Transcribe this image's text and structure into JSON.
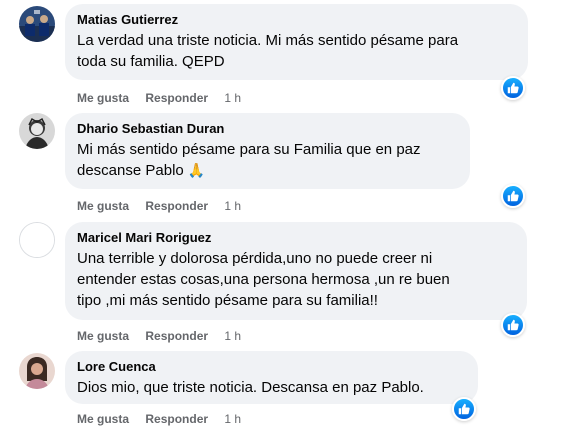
{
  "colors": {
    "bubble_bg": "#f0f2f5",
    "action_text": "#65676b",
    "like_blue": "#1877f2"
  },
  "comments": [
    {
      "author": "Matias Gutierrez",
      "lines": [
        "La verdad una triste noticia. Mi más sentido pésame para",
        "toda su familia. QEPD"
      ],
      "like_label": "Me gusta",
      "reply_label": "Responder",
      "time": "1 h",
      "reaction_icon": "like-icon",
      "avatar_icon": "team-photo-avatar"
    },
    {
      "author": "Dhario Sebastian Duran",
      "lines": [
        "Mi más sentido pésame para su Familia que en paz",
        "descanse Pablo"
      ],
      "emoji": "🙏",
      "like_label": "Me gusta",
      "reply_label": "Responder",
      "time": "1 h",
      "reaction_icon": "like-icon",
      "avatar_icon": "portrait-avatar"
    },
    {
      "author": "Maricel Mari Roriguez",
      "lines": [
        "Una terrible y dolorosa pérdida,uno no puede creer ni",
        "entender estas cosas,una persona hermosa ,un re buen",
        "tipo ,mi más sentido pésame para su familia!!"
      ],
      "like_label": "Me gusta",
      "reply_label": "Responder",
      "time": "1 h",
      "reaction_icon": "like-icon",
      "avatar_icon": "blank-avatar"
    },
    {
      "author": "Lore Cuenca",
      "lines": [
        "Dios mio, que triste noticia. Descansa en paz Pablo."
      ],
      "like_label": "Me gusta",
      "reply_label": "Responder",
      "time": "1 h",
      "reaction_icon": "like-icon",
      "avatar_icon": "woman-photo-avatar"
    }
  ]
}
